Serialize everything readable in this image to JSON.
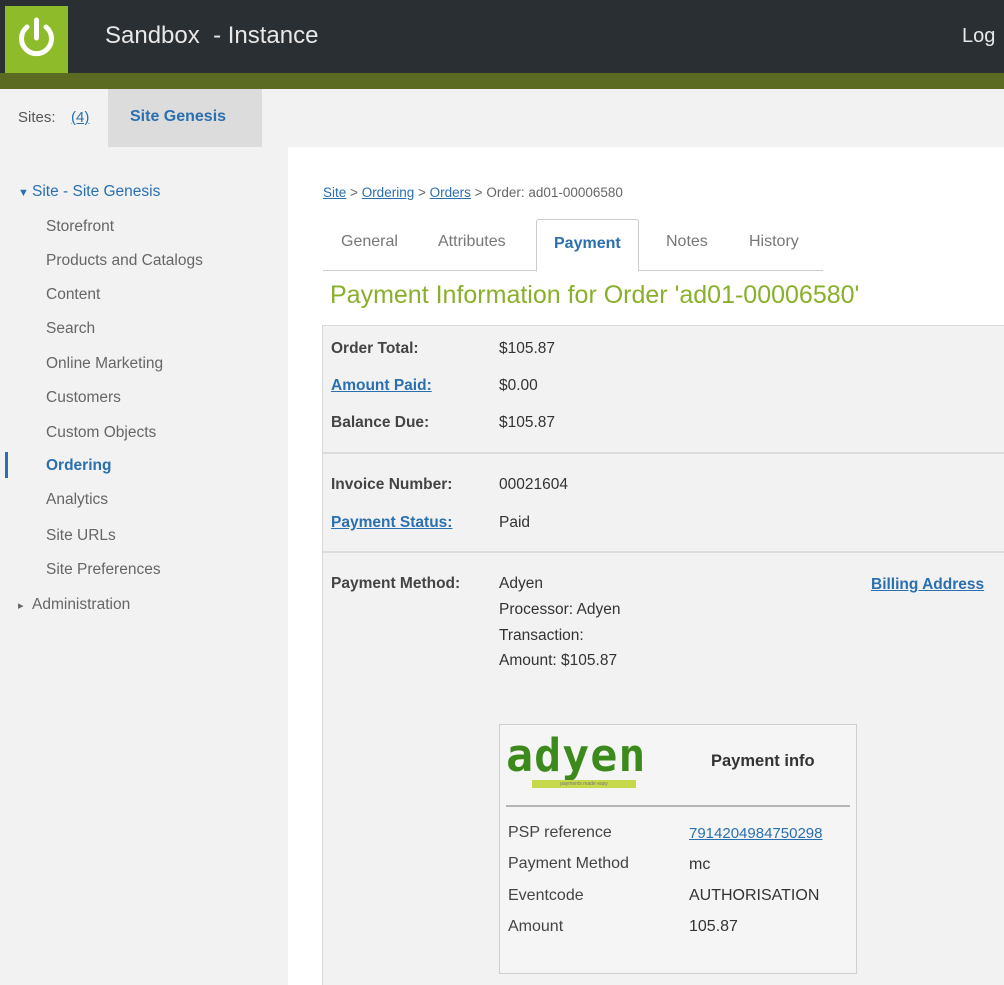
{
  "header": {
    "title": "Sandbox  - Instance",
    "login_label": "Log"
  },
  "sites": {
    "label": "Sites:",
    "count": "(4)",
    "current_site": "Site Genesis"
  },
  "sidebar": {
    "site_section": "Site - Site Genesis",
    "items": [
      {
        "label": "Storefront"
      },
      {
        "label": "Products and Catalogs"
      },
      {
        "label": "Content"
      },
      {
        "label": "Search"
      },
      {
        "label": "Online Marketing"
      },
      {
        "label": "Customers"
      },
      {
        "label": "Custom Objects"
      },
      {
        "label": "Ordering",
        "active": true
      },
      {
        "label": "Analytics"
      },
      {
        "label": "Site URLs"
      },
      {
        "label": "Site Preferences"
      }
    ],
    "admin_section": "Administration"
  },
  "breadcrumb": {
    "site": "Site",
    "ordering": "Ordering",
    "orders": "Orders",
    "sep": ">",
    "current": "Order: ad01-00006580"
  },
  "tabs": [
    {
      "label": "General"
    },
    {
      "label": "Attributes"
    },
    {
      "label": "Payment",
      "active": true
    },
    {
      "label": "Notes"
    },
    {
      "label": "History"
    }
  ],
  "page_title": "Payment Information for Order 'ad01-00006580'",
  "totals": {
    "order_total_label": "Order Total:",
    "order_total": "$105.87",
    "amount_paid_label": "Amount Paid:",
    "amount_paid": "$0.00",
    "balance_due_label": "Balance Due:",
    "balance_due": "$105.87"
  },
  "invoice": {
    "invoice_number_label": "Invoice Number:",
    "invoice_number": "00021604",
    "payment_status_label": "Payment Status:",
    "payment_status": "Paid"
  },
  "payment_method": {
    "label": "Payment Method:",
    "method": "Adyen",
    "processor": "Processor: Adyen",
    "transaction": "Transaction:",
    "amount": "Amount: $105.87",
    "billing_address_label": "Billing Address"
  },
  "adyen": {
    "logo_text": "adyen",
    "logo_tagline": "payments made easy",
    "heading": "Payment info",
    "rows": [
      {
        "label": "PSP reference",
        "value": "7914204984750298"
      },
      {
        "label": "Payment Method",
        "value": "mc"
      },
      {
        "label": "Eventcode",
        "value": "AUTHORISATION"
      },
      {
        "label": "Amount",
        "value": "105.87"
      }
    ]
  },
  "colors": {
    "accent_green": "#88b02a",
    "link_blue": "#2a6fb0",
    "topbar": "#2a2f33"
  }
}
